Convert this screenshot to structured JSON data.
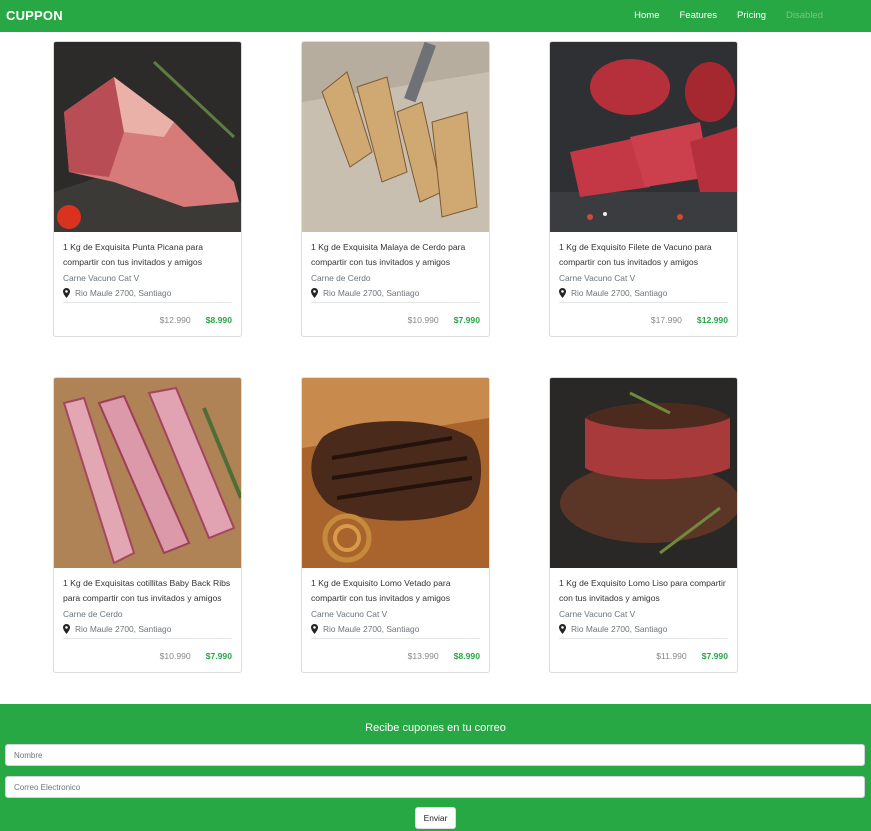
{
  "navbar": {
    "brand": "CUPPON",
    "links": [
      "Home",
      "Features",
      "Pricing",
      "Disabled"
    ]
  },
  "products": [
    {
      "title": "1 Kg de Exquisita Punta Picana para compartir con tus invitados y amigos",
      "category": "Carne Vacuno Cat V",
      "location": "Rio Maule 2700, Santiago",
      "old_price": "$12.990",
      "new_price": "$8.990"
    },
    {
      "title": "1 Kg de Exquisita Malaya de Cerdo para compartir con tus invitados y amigos",
      "category": "Carne de Cerdo",
      "location": "Rio Maule 2700, Santiago",
      "old_price": "$10.990",
      "new_price": "$7.990"
    },
    {
      "title": "1 Kg de Exquisito Filete de Vacuno para compartir con tus invitados y amigos",
      "category": "Carne Vacuno Cat V",
      "location": "Rio Maule 2700, Santiago",
      "old_price": "$17.990",
      "new_price": "$12.990"
    },
    {
      "title": "1 Kg de Exquisitas cotillitas Baby Back Ribs para compartir con tus invitados y amigos",
      "category": "Carne de Cerdo",
      "location": "Rio Maule 2700, Santiago",
      "old_price": "$10.990",
      "new_price": "$7.990"
    },
    {
      "title": "1 Kg de Exquisito Lomo Vetado para compartir con tus invitados y amigos",
      "category": "Carne Vacuno Cat V",
      "location": "Rio Maule 2700, Santiago",
      "old_price": "$13.990",
      "new_price": "$8.990"
    },
    {
      "title": "1 Kg de Exquisito Lomo Liso para compartir con tus invitados y amigos",
      "category": "Carne Vacuno Cat V",
      "location": "Rio Maule 2700, Santiago",
      "old_price": "$11.990",
      "new_price": "$7.990"
    }
  ],
  "newsletter": {
    "title": "Recibe cupones en tu correo",
    "name_placeholder": "Nombre",
    "email_placeholder": "Correo Electronico",
    "submit_label": "Enviar"
  },
  "colors": {
    "brand": "#28a745",
    "price_new": "#28a745",
    "price_old": "#888888"
  },
  "icons": {
    "location": "map-pin-icon"
  }
}
